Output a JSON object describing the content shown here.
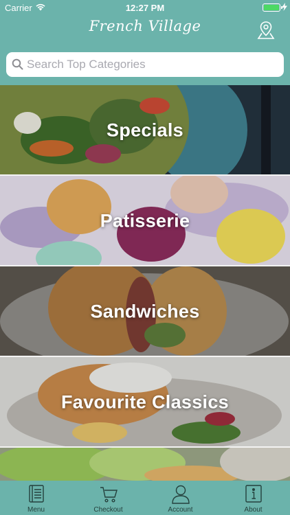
{
  "status_bar": {
    "carrier": "Carrier",
    "time": "12:27 PM"
  },
  "header": {
    "title": "French Village",
    "location_icon": "map-pin-icon"
  },
  "search": {
    "placeholder": "Search Top Categories",
    "value": ""
  },
  "categories": [
    {
      "label": "Specials"
    },
    {
      "label": "Patisserie"
    },
    {
      "label": "Sandwiches"
    },
    {
      "label": "Favourite Classics"
    },
    {
      "label": ""
    }
  ],
  "tabbar": {
    "items": [
      {
        "label": "Menu",
        "icon": "menu-book-icon"
      },
      {
        "label": "Checkout",
        "icon": "cart-icon"
      },
      {
        "label": "Account",
        "icon": "user-icon"
      },
      {
        "label": "About",
        "icon": "info-icon"
      }
    ]
  },
  "colors": {
    "brand": "#6bb3ab",
    "battery": "#4cd964",
    "tab_label": "#24403c"
  }
}
